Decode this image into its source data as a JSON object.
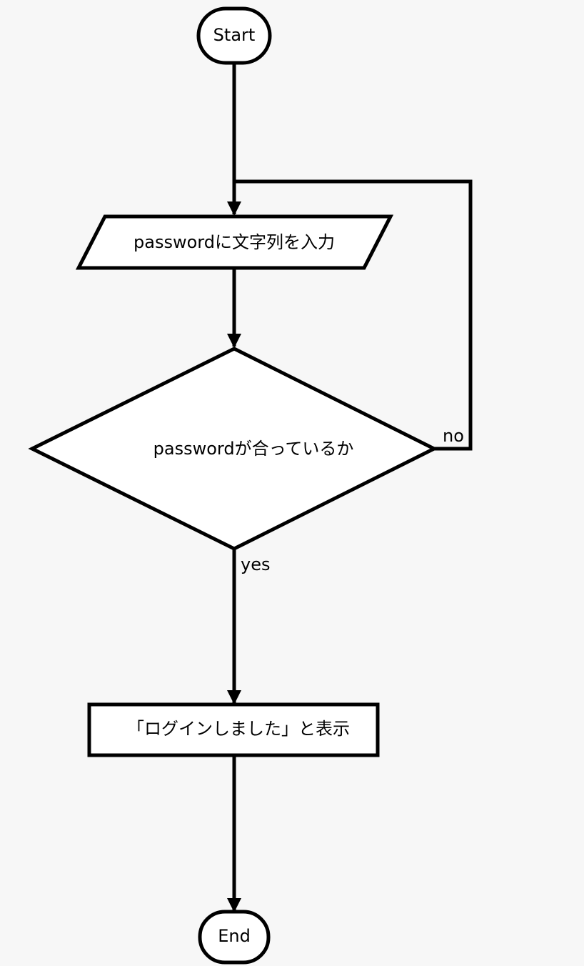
{
  "diagram": {
    "type": "flowchart",
    "nodes": {
      "start": {
        "shape": "terminator",
        "label": "Start"
      },
      "input": {
        "shape": "parallelogram",
        "label": "passwordに文字列を入力"
      },
      "decision": {
        "shape": "diamond",
        "label": "passwordが合っているか"
      },
      "display": {
        "shape": "rectangle",
        "label": "「ログインしました」と表示"
      },
      "end": {
        "shape": "terminator",
        "label": "End"
      }
    },
    "edges": [
      {
        "from": "start",
        "to": "input",
        "label": ""
      },
      {
        "from": "input",
        "to": "decision",
        "label": ""
      },
      {
        "from": "decision",
        "to": "input",
        "label": "no"
      },
      {
        "from": "decision",
        "to": "display",
        "label": "yes"
      },
      {
        "from": "display",
        "to": "end",
        "label": ""
      }
    ],
    "edge_labels": {
      "no": "no",
      "yes": "yes"
    },
    "colors": {
      "stroke": "#000000",
      "fill": "#ffffff",
      "background": "#f7f7f7"
    }
  }
}
